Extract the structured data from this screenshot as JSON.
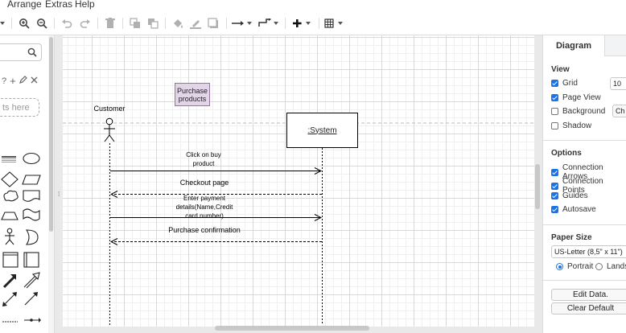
{
  "menubar": {
    "arrange": "Arrange",
    "extras": "Extras",
    "help": "Help"
  },
  "left_panel": {
    "drop_hint": "ts here"
  },
  "diagram": {
    "actor_label": "Customer",
    "purchase_note": "Purchase products",
    "system_label": ":System",
    "messages": [
      {
        "text": "Click on buy product",
        "style": "solid"
      },
      {
        "text": "Checkout page",
        "style": "dashed"
      },
      {
        "text": "Enter payment details(Name,Credit card number)",
        "style": "solid"
      },
      {
        "text": "Purchase confirmation",
        "style": "dashed"
      }
    ]
  },
  "format_panel": {
    "tab_diagram": "Diagram",
    "view_heading": "View",
    "view_options": [
      {
        "label": "Grid",
        "checked": true
      },
      {
        "label": "Page View",
        "checked": true
      },
      {
        "label": "Background",
        "checked": false
      },
      {
        "label": "Shadow",
        "checked": false
      }
    ],
    "grid_size_value": "10",
    "background_button": "Ch",
    "options_heading": "Options",
    "options": [
      {
        "label": "Connection Arrows",
        "checked": true
      },
      {
        "label": "Connection Points",
        "checked": true
      },
      {
        "label": "Guides",
        "checked": true
      },
      {
        "label": "Autosave",
        "checked": true
      }
    ],
    "paper_heading": "Paper Size",
    "paper_value": "US-Letter (8,5\" x 11\")",
    "orientation": [
      {
        "label": "Portrait",
        "selected": true
      },
      {
        "label": "Landsc",
        "selected": false
      }
    ],
    "edit_data_button": "Edit Data.",
    "clear_default_button": "Clear Default"
  },
  "icons": [
    "zoom-in-icon",
    "zoom-out-icon",
    "undo-icon",
    "redo-icon",
    "delete-icon",
    "to-front-icon",
    "to-back-icon",
    "fill-color-icon",
    "line-color-icon",
    "shadow-icon",
    "connection-icon",
    "waypoint-icon",
    "insert-icon",
    "table-icon",
    "search-icon"
  ],
  "colors": {
    "note_fill": "#e1d5e7",
    "note_stroke": "#9673a6",
    "accent": "#1a73e8"
  }
}
